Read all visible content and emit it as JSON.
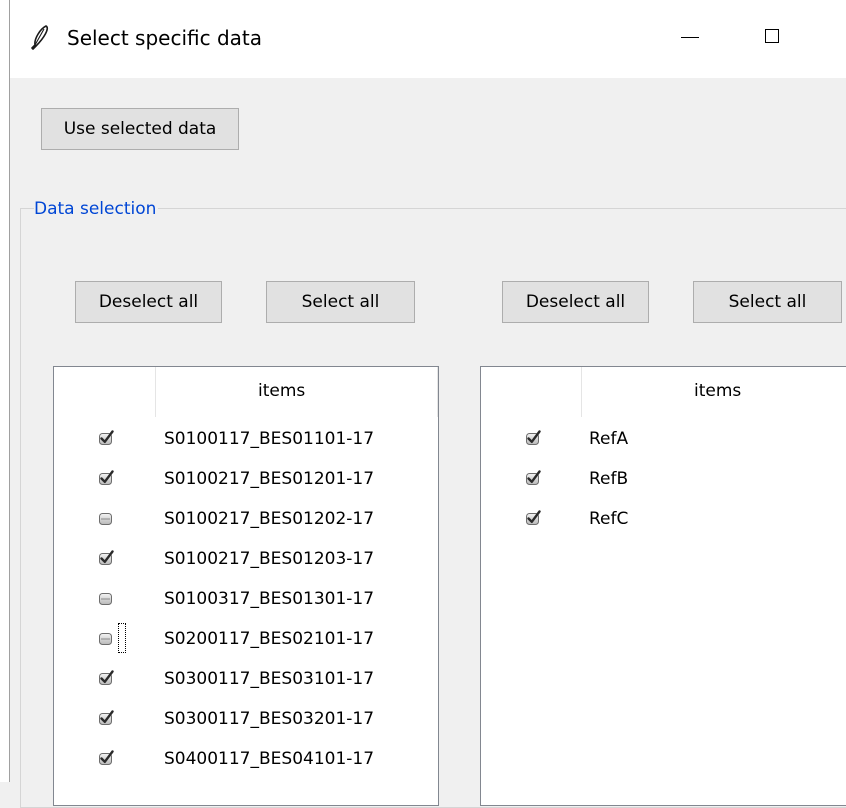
{
  "window": {
    "title": "Select specific data",
    "icon": "feather-icon"
  },
  "toolbar": {
    "use_selected_label": "Use selected data"
  },
  "data_selection": {
    "legend": "Data selection",
    "left": {
      "deselect_label": "Deselect all",
      "select_label": "Select all",
      "column_header": "items",
      "items": [
        {
          "label": "S0100117_BES01101-17",
          "checked": true
        },
        {
          "label": "S0100217_BES01201-17",
          "checked": true
        },
        {
          "label": "S0100217_BES01202-17",
          "checked": false
        },
        {
          "label": "S0100217_BES01203-17",
          "checked": true
        },
        {
          "label": "S0100317_BES01301-17",
          "checked": false
        },
        {
          "label": "S0200117_BES02101-17",
          "checked": false,
          "focused": true
        },
        {
          "label": "S0300117_BES03101-17",
          "checked": true
        },
        {
          "label": "S0300117_BES03201-17",
          "checked": true
        },
        {
          "label": "S0400117_BES04101-17",
          "checked": true
        }
      ]
    },
    "right": {
      "deselect_label": "Deselect all",
      "select_label": "Select all",
      "column_header": "items",
      "items": [
        {
          "label": "RefA",
          "checked": true
        },
        {
          "label": "RefB",
          "checked": true
        },
        {
          "label": "RefC",
          "checked": true
        }
      ]
    }
  }
}
